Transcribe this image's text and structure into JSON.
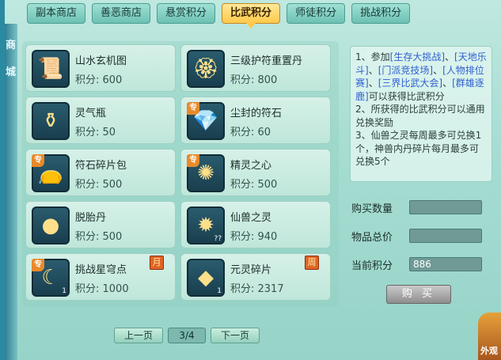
{
  "tabs": [
    {
      "label": "副本商店"
    },
    {
      "label": "善恶商店"
    },
    {
      "label": "悬赏积分"
    },
    {
      "label": "比武积分"
    },
    {
      "label": "师徒积分"
    },
    {
      "label": "挑战积分"
    }
  ],
  "side_text": [
    "商",
    "城"
  ],
  "score_prefix": "积分: ",
  "items": [
    {
      "name": "山水玄机图",
      "score": "600",
      "icon": "scroll-icon",
      "tag": "",
      "count": "",
      "limit": ""
    },
    {
      "name": "三级护符重置丹",
      "score": "800",
      "icon": "golden-talisman-icon",
      "tag": "",
      "count": "",
      "limit": ""
    },
    {
      "name": "灵气瓶",
      "score": "50",
      "icon": "vase-icon",
      "tag": "",
      "count": "",
      "limit": ""
    },
    {
      "name": "尘封的符石",
      "score": "60",
      "icon": "rune-stone-icon",
      "tag": "专",
      "count": "",
      "limit": ""
    },
    {
      "name": "符石碎片包",
      "score": "500",
      "icon": "bag-icon",
      "tag": "专",
      "count": "",
      "limit": ""
    },
    {
      "name": "精灵之心",
      "score": "500",
      "icon": "spirit-heart-icon",
      "tag": "专",
      "count": "",
      "limit": ""
    },
    {
      "name": "脱胎丹",
      "score": "500",
      "icon": "pill-icon",
      "tag": "",
      "count": "",
      "limit": ""
    },
    {
      "name": "仙兽之灵",
      "score": "940",
      "icon": "beast-spirit-icon",
      "tag": "",
      "count": "??",
      "limit": ""
    },
    {
      "name": "挑战星穹点",
      "score": "1000",
      "icon": "crescent-moon-icon",
      "tag": "专",
      "count": "1",
      "limit": "月"
    },
    {
      "name": "元灵碎片",
      "score": "2317",
      "icon": "gold-shard-icon",
      "tag": "",
      "count": "1",
      "limit": "周"
    }
  ],
  "pager": {
    "prev": "上一页",
    "page": "3/4",
    "next": "下一页"
  },
  "description": {
    "l1a": "1、参加",
    "l1b": "[生存大挑战]",
    "l1c": "、",
    "l1d": "[天地乐斗]",
    "l1e": "、",
    "l1f": "[门派竞技场]",
    "l1g": "、",
    "l1h": "[人物排位赛]",
    "l1i": "、",
    "l1j": "[三界比武大会]",
    "l1k": "、",
    "l1l": "[群雄逐鹿]",
    "l1m": "可以获得比武积分",
    "l2": "2、所获得的比武积分可以通用兑换奖励",
    "l3": "3、仙兽之灵每周最多可兑换1个，神兽内丹碎片每月最多可兑换5个"
  },
  "fields": {
    "qty_label": "购买数量",
    "qty_value": "",
    "total_label": "物品总价",
    "total_value": "",
    "current_label": "当前积分",
    "current_value": "886"
  },
  "buy_label": "购 买",
  "corner_label": "外观"
}
